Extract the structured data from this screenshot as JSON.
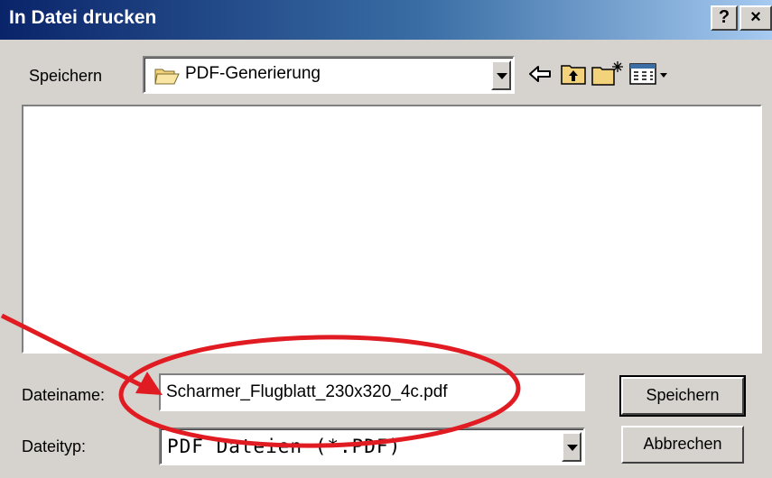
{
  "window": {
    "title": "In Datei drucken",
    "help_label": "?",
    "close_label": "×"
  },
  "save_in": {
    "label": "Speichern",
    "folder": "PDF-Generierung",
    "folder_icon": "folder-icon"
  },
  "toolbar": {
    "icons": [
      "back-arrow-icon",
      "up-folder-icon",
      "new-folder-icon",
      "view-menu-icon"
    ]
  },
  "file_name": {
    "label": "Dateiname:",
    "value": "Scharmer_Flugblatt_230x320_4c.pdf"
  },
  "file_type": {
    "label": "Dateityp:",
    "value": "PDF Dateien (*.PDF)"
  },
  "buttons": {
    "save": "Speichern",
    "cancel": "Abbrechen"
  },
  "annotation": {
    "color": "#e01b22"
  }
}
